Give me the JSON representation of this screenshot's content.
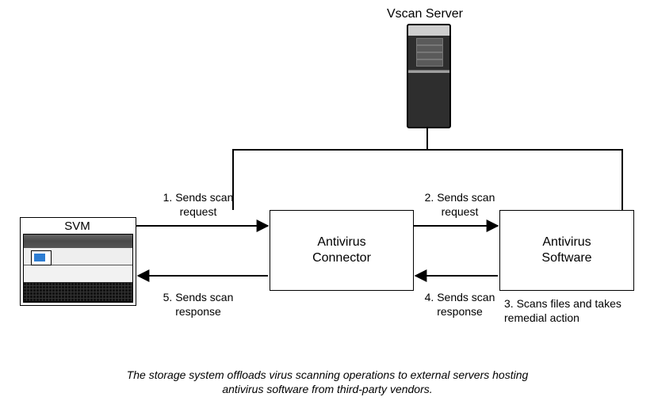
{
  "title_vscan": "Vscan Server",
  "svm": {
    "label": "SVM"
  },
  "boxes": {
    "connector": "Antivirus\nConnector",
    "software": "Antivirus\nSoftware"
  },
  "steps": {
    "s1": "1. Sends scan request",
    "s2": "2. Sends scan request",
    "s3": "3. Scans files and takes remedial action",
    "s4": "4. Sends scan response",
    "s5": "5. Sends scan response"
  },
  "caption": "The storage system offloads virus scanning operations to external servers hosting antivirus software from third-party vendors."
}
